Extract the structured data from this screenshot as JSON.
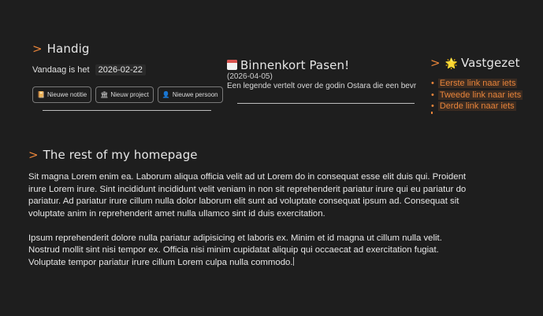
{
  "handig": {
    "prefix": ">",
    "title": "Handig",
    "today_label": "Vandaag is het",
    "today_value": "2026-02-22",
    "buttons": [
      {
        "label": "Nieuwe notitie",
        "icon": "notebook-icon"
      },
      {
        "label": "Nieuw project",
        "icon": "classical-building-icon"
      },
      {
        "label": "Nieuwe persoon",
        "icon": "person-icon"
      }
    ]
  },
  "binnenkort": {
    "title": "Binnenkort Pasen!",
    "icon": "calendar-icon",
    "date": "(2026-04-05)",
    "description": "Een legende vertelt over de godin Ostara die een bevroren"
  },
  "vastgezet": {
    "prefix": ">",
    "title": "Vastgezet",
    "icon": "glowing-star-icon",
    "links": [
      "Eerste link naar iets",
      "Tweede link naar iets",
      "Derde link naar iets"
    ]
  },
  "rest": {
    "prefix": ">",
    "title": "The rest of my homepage",
    "paragraphs": [
      "Sit magna Lorem enim ea. Laborum aliqua officia velit ad ut Lorem do in consequat esse elit duis qui. Proident irure Lorem irure. Sint incididunt incididunt velit veniam in non sit reprehenderit pariatur irure qui eu pariatur do pariatur. Ad pariatur irure cillum nulla dolor laborum elit sunt ad voluptate consequat ipsum ad. Consequat sit voluptate anim in reprehenderit amet nulla ullamco sint id duis exercitation.",
      "Ipsum reprehenderit dolore nulla pariatur adipisicing et laboris ex. Minim et id magna ut cillum nulla velit. Nostrud mollit sint nisi tempor ex. Officia nisi minim cupidatat aliquip qui occaecat ad exercitation fugiat. Voluptate tempor pariatur irure cillum Lorem culpa nulla commodo."
    ]
  },
  "colors": {
    "background": "#1e1e1e",
    "accent": "#e8843a",
    "text": "#e6e6e6"
  }
}
